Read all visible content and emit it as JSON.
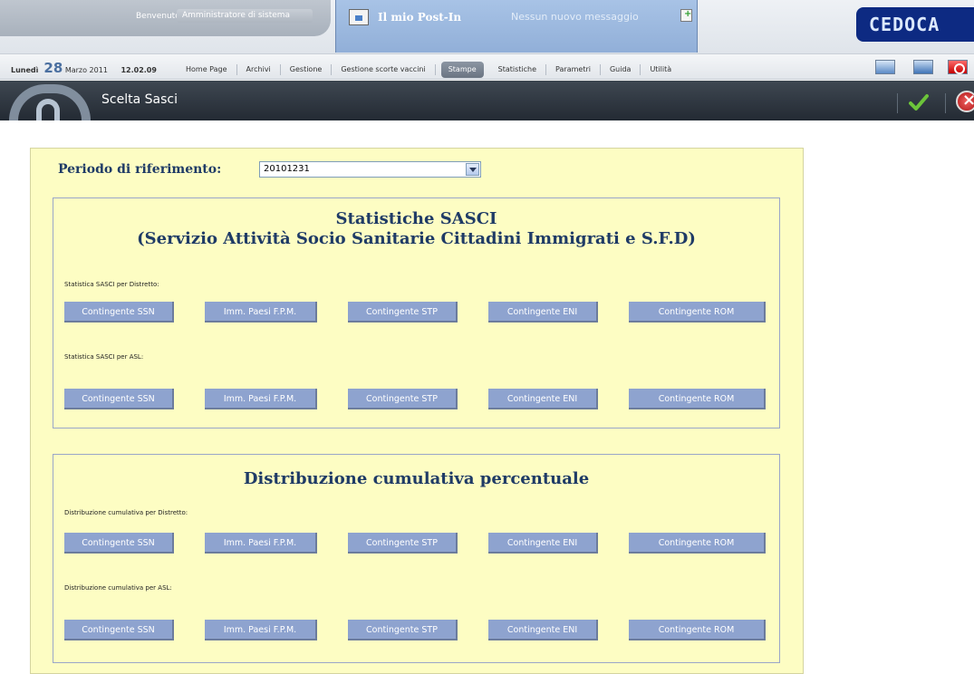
{
  "header": {
    "welcome_label": "Benvenuto",
    "user": "Amministratore di sistema",
    "postin_title": "Il mio Post-In",
    "postin_message": "Nessun nuovo messaggio",
    "logo": "CEDOCA",
    "day_name": "Lunedì",
    "day_number": "28",
    "month_year": "Marzo 2011",
    "time": "12.02.09"
  },
  "nav": {
    "items": [
      "Home Page",
      "Archivi",
      "Gestione",
      "Gestione scorte vaccini",
      "Stampe",
      "Statistiche",
      "Parametri",
      "Guida",
      "Utilità"
    ],
    "active": "Stampe"
  },
  "page": {
    "title": "Scelta Sasci"
  },
  "form": {
    "periodo_label": "Periodo di riferimento:",
    "periodo_value": "20101231"
  },
  "sections": [
    {
      "title_line1": "Statistiche SASCI",
      "title_line2": "(Servizio Attività Socio Sanitarie Cittadini Immigrati e S.F.D)",
      "groups": [
        {
          "label": "Statistica SASCI per Distretto:",
          "buttons": [
            "Contingente SSN",
            "Imm. Paesi F.P.M.",
            "Contingente STP",
            "Contingente ENI",
            "Contingente ROM"
          ]
        },
        {
          "label": "Statistica SASCI per ASL:",
          "buttons": [
            "Contingente SSN",
            "Imm. Paesi F.P.M.",
            "Contingente STP",
            "Contingente ENI",
            "Contingente ROM"
          ]
        }
      ]
    },
    {
      "title_line1": "Distribuzione cumulativa percentuale",
      "groups": [
        {
          "label": "Distribuzione cumulativa per Distretto:",
          "buttons": [
            "Contingente SSN",
            "Imm. Paesi F.P.M.",
            "Contingente STP",
            "Contingente ENI",
            "Contingente ROM"
          ]
        },
        {
          "label": "Distribuzione cumulativa per ASL:",
          "buttons": [
            "Contingente SSN",
            "Imm. Paesi F.P.M.",
            "Contingente STP",
            "Contingente ENI",
            "Contingente ROM"
          ]
        }
      ]
    }
  ],
  "icons": {
    "postin": "note-icon",
    "new_note": "add-note-icon",
    "tool_a": "window-icon",
    "tool_b": "monitor-icon",
    "tool_c": "power-icon",
    "confirm": "checkmark-icon",
    "cancel": "close-icon"
  }
}
